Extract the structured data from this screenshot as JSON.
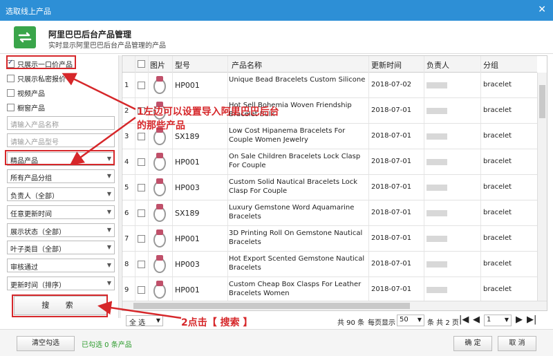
{
  "window": {
    "title": "选取线上产品",
    "close_icon": "close-icon"
  },
  "header": {
    "title": "阿里巴巴后台产品管理",
    "subtitle": "实时显示阿里巴巴后台产品管理的产品",
    "logo_icon": "refresh-icon",
    "logo_color": "#3aa54a"
  },
  "filters": {
    "checkboxes": [
      {
        "label": "只展示一口价产品",
        "checked": true
      },
      {
        "label": "只展示私密报价",
        "checked": false
      },
      {
        "label": "视频产品",
        "checked": false
      },
      {
        "label": "橱窗产品",
        "checked": false
      }
    ],
    "name_placeholder": "请输入产品名称",
    "model_placeholder": "请输入产品型号",
    "selects": [
      "精品产品",
      "所有产品分组",
      "负责人（全部）",
      "任意更新时间",
      "展示状态（全部）",
      "叶子类目（全部）",
      "审核通过",
      "更新时间（排序）"
    ],
    "search_label": "搜 索"
  },
  "table": {
    "headers": {
      "image": "图片",
      "model": "型号",
      "name": "产品名称",
      "date": "更新时间",
      "owner": "负责人",
      "group": "分组"
    },
    "rows": [
      {
        "num": "1",
        "model": "HP001",
        "name": "Unique Bead Bracelets Custom Silicone",
        "date": "2018-07-02",
        "group": "bracelet"
      },
      {
        "num": "2",
        "model": "",
        "name": "Hot Sell Bohemia Woven Friendship Bracelet Bulk",
        "date": "2018-07-01",
        "group": "bracelet"
      },
      {
        "num": "3",
        "model": "SX189",
        "name": "Low Cost Hipanema Bracelets For Couple Women Jewelry",
        "date": "2018-07-01",
        "group": "bracelet"
      },
      {
        "num": "4",
        "model": "HP001",
        "name": "On Sale Children Bracelets Lock Clasp For Couple",
        "date": "2018-07-01",
        "group": "bracelet"
      },
      {
        "num": "5",
        "model": "HP003",
        "name": "Custom Solid Nautical Bracelets Lock Clasp For Couple",
        "date": "2018-07-01",
        "group": "bracelet"
      },
      {
        "num": "6",
        "model": "SX189",
        "name": "Luxury Gemstone Word Aquamarine Bracelets",
        "date": "2018-07-01",
        "group": "bracelet"
      },
      {
        "num": "7",
        "model": "HP001",
        "name": "3D Printing Roll On Gemstone Nautical Bracelets",
        "date": "2018-07-01",
        "group": "bracelet"
      },
      {
        "num": "8",
        "model": "HP003",
        "name": "Hot Export Scented Gemstone Nautical Bracelets",
        "date": "2018-07-01",
        "group": "bracelet"
      },
      {
        "num": "9",
        "model": "HP001",
        "name": "Custom Cheap Box Clasps For Leather Bracelets Women",
        "date": "2018-07-01",
        "group": "bracelet"
      }
    ]
  },
  "pager": {
    "select_all": "全 选",
    "total": "共 90 条",
    "per_page_label": "每页显示",
    "per_page": "50",
    "pages_text": "条 共 2 页",
    "current_page": "1"
  },
  "footer": {
    "clear_label": "清空勾选",
    "selected_text": "已勾选 0 条产品",
    "confirm_label": "确 定",
    "cancel_label": "取 消"
  },
  "annotations": {
    "left_note_line1": "1左边可以设置导入阿里巴巴后台",
    "left_note_line2": "的那些产品",
    "search_note": "2点击【 搜索 】",
    "color": "#d6272a"
  }
}
